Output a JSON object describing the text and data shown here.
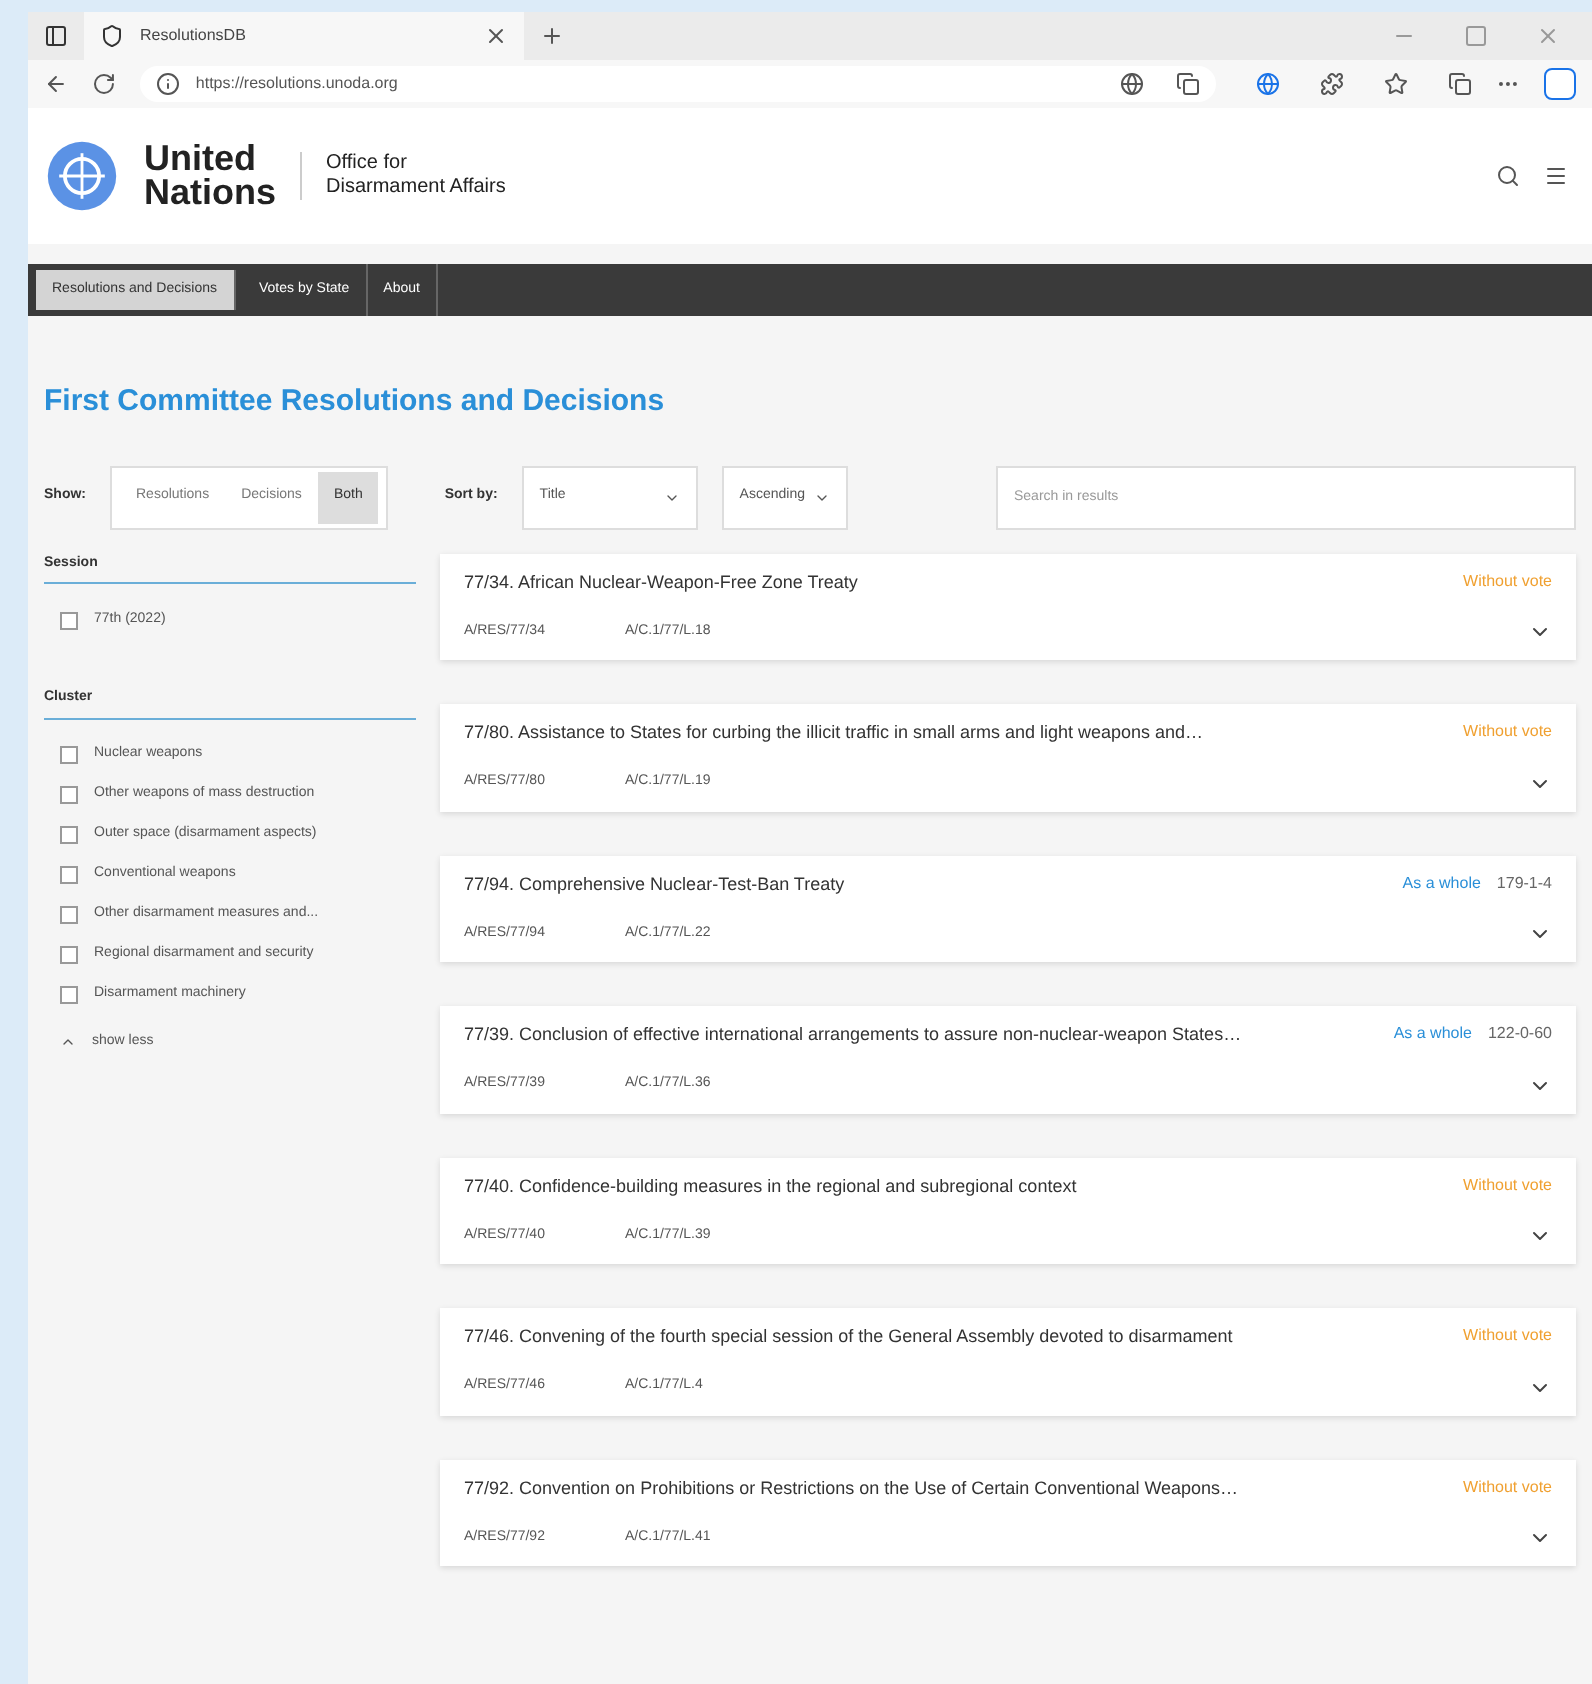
{
  "browser": {
    "tab_title": "ResolutionsDB",
    "url": "https://resolutions.unoda.org"
  },
  "header": {
    "logo_line1": "United",
    "logo_line2": "Nations",
    "office_line1": "Office for",
    "office_line2": "Disarmament Affairs"
  },
  "nav": [
    {
      "label": "Resolutions and Decisions",
      "selected": true
    },
    {
      "label": "Votes by State",
      "selected": false
    },
    {
      "label": "About",
      "selected": false
    }
  ],
  "title": "First Committee Resolutions and Decisions",
  "show": {
    "label": "Show:",
    "options": [
      {
        "label": "Resolutions",
        "selected": false
      },
      {
        "label": "Decisions",
        "selected": false
      },
      {
        "label": "Both",
        "selected": true
      }
    ]
  },
  "sort": {
    "label": "Sort by:",
    "field": "Title",
    "order": "Ascending"
  },
  "search": {
    "placeholder": "Search in results"
  },
  "filters": [
    {
      "heading": "Session",
      "options": [
        {
          "label": "77th (2022)",
          "checked": false
        }
      ]
    },
    {
      "heading": "Cluster",
      "options": [
        {
          "label": "Nuclear weapons",
          "checked": false
        },
        {
          "label": "Other weapons of mass destruction",
          "checked": false
        },
        {
          "label": "Outer space (disarmament aspects)",
          "checked": false
        },
        {
          "label": "Conventional weapons",
          "checked": false
        },
        {
          "label": "Other disarmament measures and...",
          "checked": false
        },
        {
          "label": "Regional disarmament and security",
          "checked": false
        },
        {
          "label": "Disarmament machinery",
          "checked": false
        }
      ]
    }
  ],
  "show_less": "show less",
  "results": [
    {
      "title": "77/34. African Nuclear-Weapon-Free Zone Treaty",
      "symbol": "A/RES/77/34",
      "draft": "A/C.1/77/L.18",
      "kind": "consensus",
      "vote": "Without vote"
    },
    {
      "title": "77/80. Assistance to States for curbing the illicit traffic in small arms and light weapons and…",
      "symbol": "A/RES/77/80",
      "draft": "A/C.1/77/L.19",
      "kind": "consensus",
      "vote": "Without vote"
    },
    {
      "title": "77/94. Comprehensive Nuclear-Test-Ban Treaty",
      "symbol": "A/RES/77/94",
      "draft": "A/C.1/77/L.22",
      "kind": "recorded",
      "vote": "As a whole",
      "tally": "179-1-4"
    },
    {
      "title": "77/39. Conclusion of effective international arrangements to assure non-nuclear-weapon States…",
      "symbol": "A/RES/77/39",
      "draft": "A/C.1/77/L.36",
      "kind": "recorded",
      "vote": "As a whole",
      "tally": "122-0-60"
    },
    {
      "title": "77/40. Confidence-building measures in the regional and subregional context",
      "symbol": "A/RES/77/40",
      "draft": "A/C.1/77/L.39",
      "kind": "consensus",
      "vote": "Without vote"
    },
    {
      "title": "77/46. Convening of the fourth special session of the General Assembly devoted to disarmament",
      "symbol": "A/RES/77/46",
      "draft": "A/C.1/77/L.4",
      "kind": "consensus",
      "vote": "Without vote"
    },
    {
      "title": "77/92. Convention on Prohibitions or Restrictions on the Use of Certain Conventional Weapons…",
      "symbol": "A/RES/77/92",
      "draft": "A/C.1/77/L.41",
      "kind": "consensus",
      "vote": "Without vote"
    }
  ]
}
